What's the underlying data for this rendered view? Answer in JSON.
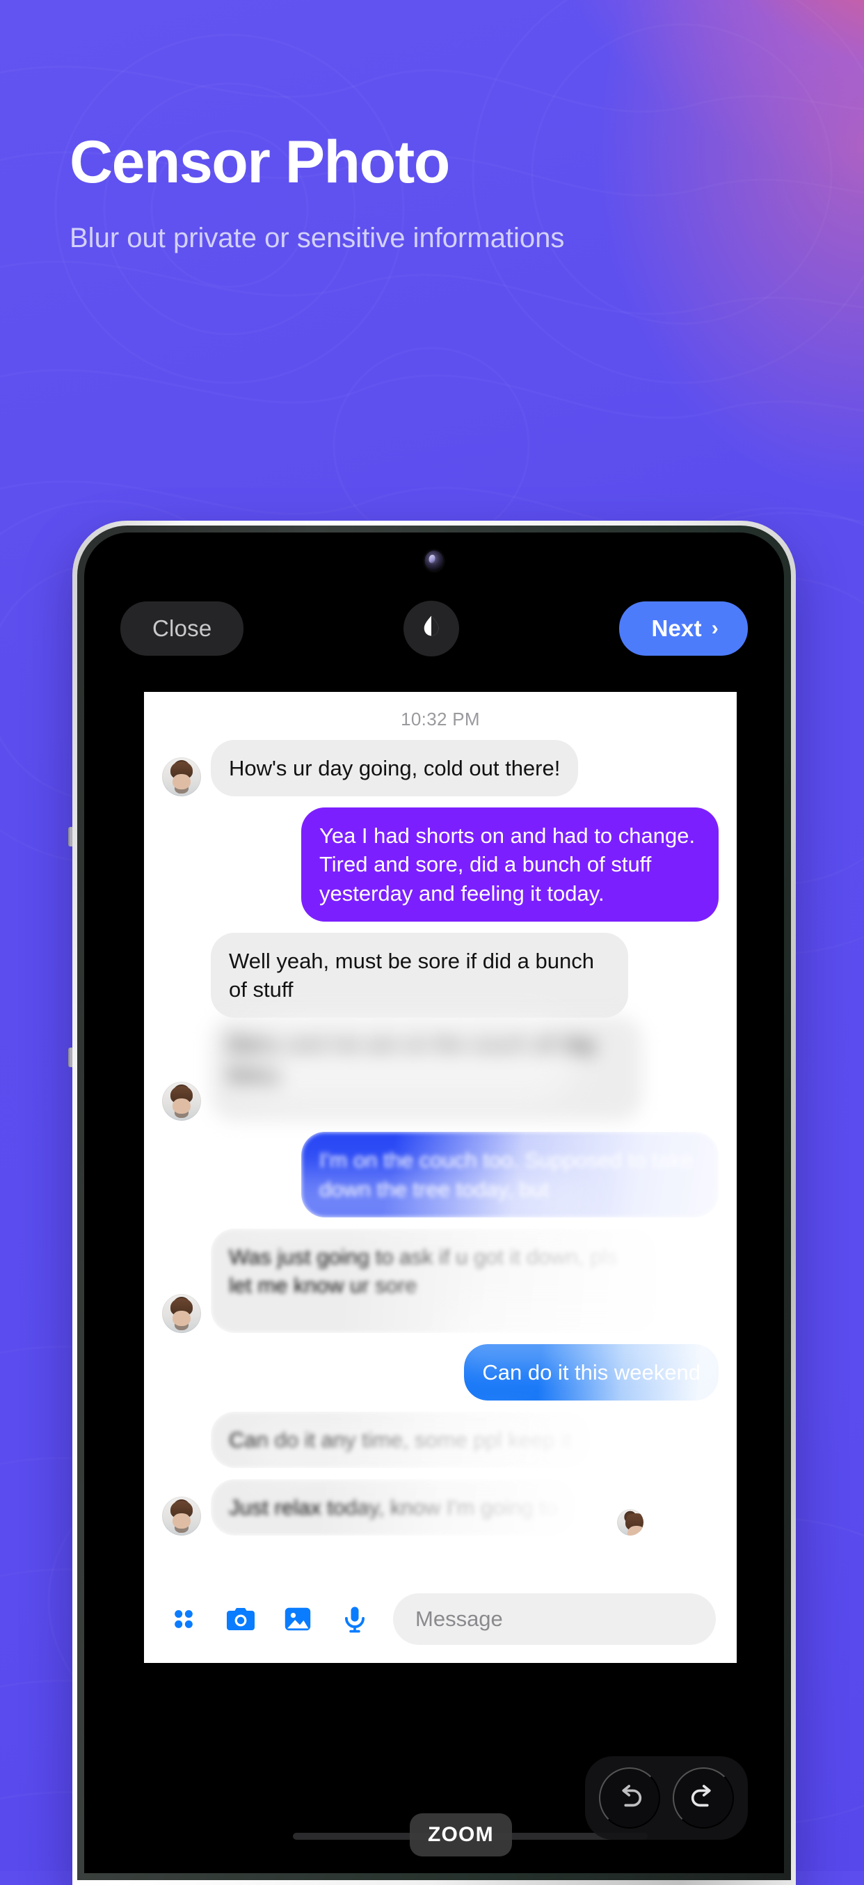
{
  "promo": {
    "title": "Censor Photo",
    "subtitle": "Blur out private or sensitive informations",
    "background_color": "#5B4DEE",
    "accent_pink": "#F2627E"
  },
  "editor": {
    "close_label": "Close",
    "contrast_icon": "contrast-droplet-icon",
    "next_label": "Next",
    "next_chevron": "›",
    "next_color": "#4D7CFB",
    "zoom_label": "ZOOM",
    "undo_icon": "undo-arrow-icon",
    "redo_icon": "redo-arrow-icon"
  },
  "phone": {
    "camera": "front-camera",
    "volume_up": "volume-up-button",
    "volume_down": "volume-down-button"
  },
  "chat": {
    "timestamp": "10:32 PM",
    "messages": [
      {
        "id": 1,
        "side": "in",
        "text": "How's ur day going, cold out there!",
        "censored": "none",
        "color": "#EDEDED"
      },
      {
        "id": 2,
        "side": "out",
        "text": "Yea I had shorts on and had to change. Tired and sore, did a bunch of stuff yesterday and feeling it today.",
        "censored": "none",
        "color": "#7C1FFF"
      },
      {
        "id": 3,
        "side": "in",
        "text": "Well yeah, must be sore if did a bunch of stuff",
        "censored": "none",
        "color": "#EDEDED"
      },
      {
        "id": 4,
        "side": "in",
        "text": "Daisy and me are on the couch all day today",
        "censored": "heavy",
        "color": "#EDEDED"
      },
      {
        "id": 5,
        "side": "out",
        "text": "I'm on the couch too. Supposed to take down the tree today, but",
        "censored": "partial",
        "color": "#2A49F5"
      },
      {
        "id": 6,
        "side": "in",
        "text": "Was just going to ask if u got it down, pls let me know ur sore",
        "censored": "partial",
        "color": "#EDEDED"
      },
      {
        "id": 7,
        "side": "out",
        "text": "Can do it this weekend",
        "censored": "partial",
        "color": "#1777F7"
      },
      {
        "id": 8,
        "side": "in",
        "text": "Can do it any time, some ppl keep it",
        "censored": "partial",
        "color": "#EDEDED"
      },
      {
        "id": 9,
        "side": "in",
        "text": "Just relax today, know I'm going to",
        "censored": "partial",
        "color": "#EDEDED"
      }
    ],
    "input_placeholder": "Message",
    "input_value": "",
    "toolbar_icons": [
      "apps-grid-icon",
      "camera-icon",
      "gallery-image-icon",
      "microphone-icon"
    ],
    "icon_color": "#0A7CFF"
  }
}
